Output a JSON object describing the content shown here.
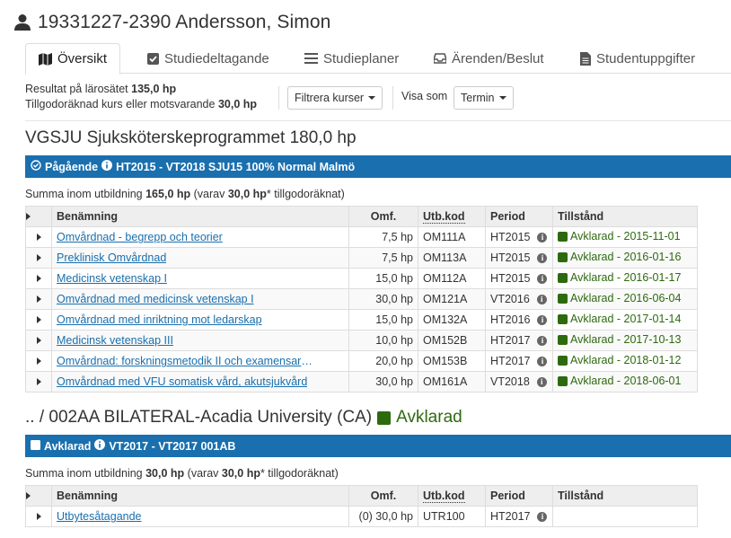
{
  "student": {
    "title": "19331227-2390 Andersson, Simon"
  },
  "tabs": [
    {
      "label": "Översikt",
      "icon": "map-icon"
    },
    {
      "label": "Studiedeltagande",
      "icon": "check-square-icon"
    },
    {
      "label": "Studieplaner",
      "icon": "list-icon"
    },
    {
      "label": "Ärenden/Beslut",
      "icon": "inbox-icon"
    },
    {
      "label": "Studentuppgifter",
      "icon": "file-text-icon"
    }
  ],
  "summary": {
    "line1_label": "Resultat på lärosätet",
    "line1_value": "135,0 hp",
    "line2_label": "Tillgodoräknad kurs eller motsvarande",
    "line2_value": "30,0 hp"
  },
  "toolbar": {
    "filter_label": "Filtrera kurser",
    "view_label": "Visa som",
    "view_value": "Termin"
  },
  "programs": [
    {
      "title": "VGSJU Sjuksköterskeprogrammet 180,0 hp",
      "status_badge": "",
      "bar_status": "Pågående",
      "bar_text": "HT2015 - VT2018 SJU15 100% Normal Malmö",
      "sum_prefix": "Summa inom utbildning",
      "sum_value": "165,0 hp",
      "sum_open": "(varav",
      "sum_credit": "30,0 hp",
      "sum_suffix": "* tillgodoräknat)",
      "headers": [
        "Benämning",
        "Omf.",
        "Utb.kod",
        "Period",
        "Tillstånd"
      ],
      "rows": [
        {
          "name": "Omvårdnad - begrepp och teorier",
          "omf": "7,5 hp",
          "kod": "OM111A",
          "period": "HT2015",
          "status": "Avklarad - 2015-11-01"
        },
        {
          "name": "Preklinisk Omvårdnad",
          "omf": "7,5 hp",
          "kod": "OM113A",
          "period": "HT2015",
          "status": "Avklarad - 2016-01-16"
        },
        {
          "name": "Medicinsk vetenskap I",
          "omf": "15,0 hp",
          "kod": "OM112A",
          "period": "HT2015",
          "status": "Avklarad - 2016-01-17"
        },
        {
          "name": "Omvårdnad med medicinsk vetenskap I",
          "omf": "30,0 hp",
          "kod": "OM121A",
          "period": "VT2016",
          "status": "Avklarad - 2016-06-04"
        },
        {
          "name": "Omvårdnad med inriktning mot ledarskap",
          "omf": "15,0 hp",
          "kod": "OM132A",
          "period": "HT2016",
          "status": "Avklarad - 2017-01-14"
        },
        {
          "name": "Medicinsk vetenskap III",
          "omf": "10,0 hp",
          "kod": "OM152B",
          "period": "HT2017",
          "status": "Avklarad - 2017-10-13"
        },
        {
          "name": "Omvårdnad: forskningsmetodik II och examensarbete",
          "omf": "20,0 hp",
          "kod": "OM153B",
          "period": "HT2017",
          "status": "Avklarad - 2018-01-12"
        },
        {
          "name": "Omvårdnad med VFU somatisk vård, akutsjukvård",
          "omf": "30,0 hp",
          "kod": "OM161A",
          "period": "VT2018",
          "status": "Avklarad - 2018-06-01"
        }
      ]
    },
    {
      "title": ".. / 002AA BILATERAL-Acadia University (CA)",
      "status_badge": "Avklarad",
      "bar_status": "Avklarad",
      "bar_text": "VT2017 - VT2017 001AB",
      "sum_prefix": "Summa inom utbildning",
      "sum_value": "30,0 hp",
      "sum_open": "(varav",
      "sum_credit": "30,0 hp",
      "sum_suffix": "* tillgodoräknat)",
      "headers": [
        "Benämning",
        "Omf.",
        "Utb.kod",
        "Period",
        "Tillstånd"
      ],
      "rows": [
        {
          "name": "Utbytesåtagande",
          "omf": "(0) 30,0 hp",
          "kod": "UTR100",
          "period": "HT2017",
          "status": ""
        }
      ]
    }
  ]
}
